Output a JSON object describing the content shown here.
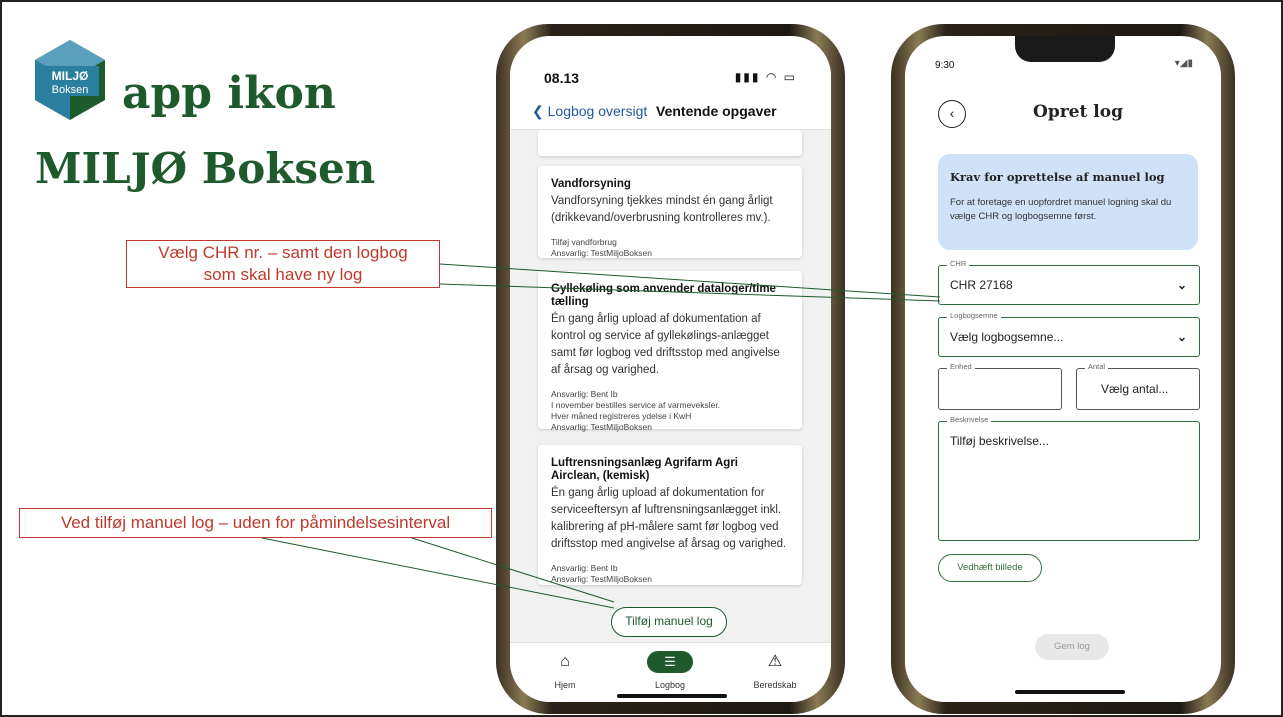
{
  "slide": {
    "title_line1": "app ikon",
    "title_line2": "MILJØ Boksen",
    "logo": {
      "icon": "miljo-boksen-logo",
      "text_top": "MILJØ",
      "text_bottom": "Boksen",
      "colors": [
        "#2a7f9e",
        "#1e5a2c",
        "#4a9ab8"
      ]
    },
    "callout1": {
      "line1": "Vælg CHR nr. – samt den logbog",
      "line2": "som skal have ny log"
    },
    "callout2": "Ved tilføj manuel log – uden for påmindelsesinterval"
  },
  "phone1": {
    "time": "08.13",
    "status_icons": "signal-icon wifi-icon battery-icon",
    "back_label": "Logbog oversigt",
    "nav_title": "Ventende opgaver",
    "cards": [
      {
        "title": "Vandforsyning",
        "desc": "Vandforsyning tjekkes mindst én gang årligt (drikkevand/overbrusning kontrolleres mv.).",
        "meta": [
          "Tilføj vandforbrug",
          "Ansvarlig: TestMiljoBoksen"
        ]
      },
      {
        "title": "Gyllekøling som anvender dataloger/time tælling",
        "desc": "Én gang årlig upload af dokumentation af kontrol og service af gyllekølings-anlægget samt før logbog ved driftsstop med angivelse af årsag og varighed.",
        "meta": [
          "Ansvarlig: Bent Ib",
          "I november bestilles service af varmeveksler.",
          "Hver måned registreres ydelse i KwH",
          "Ansvarlig: TestMiljoBoksen"
        ]
      },
      {
        "title": "Luftrensningsanlæg Agrifarm Agri Airclean, (kemisk)",
        "desc": "Én gang årlig upload af dokumentation for serviceeftersyn af luftrensningsanlægget inkl. kalibrering af pH-målere samt før logbog ved driftsstop med angivelse af årsag og varighed.",
        "meta": [
          "Ansvarlig: Bent Ib",
          "Ansvarlig: TestMiljoBoksen"
        ]
      }
    ],
    "add_button": "Tilføj manuel log",
    "tabs": [
      {
        "label": "Hjem",
        "icon": "home-icon"
      },
      {
        "label": "Logbog",
        "icon": "logbook-icon"
      },
      {
        "label": "Beredskab",
        "icon": "warning-icon"
      }
    ],
    "accent": "#1e5a2c"
  },
  "phone2": {
    "time": "9:30",
    "title": "Opret log",
    "info_title": "Krav for oprettelse af manuel log",
    "info_text": "For at foretage en uopfordret manuel logning skal du vælge CHR og logbogsemne først.",
    "fields": {
      "chr": {
        "label": "CHR",
        "value": "CHR 27168"
      },
      "logbogsemne": {
        "label": "Logbogsemne",
        "value": "Vælg logbogsemne..."
      },
      "enhed": {
        "label": "Enhed",
        "value": ""
      },
      "antal": {
        "label": "Antal",
        "value": "Vælg antal..."
      },
      "beskrivelse": {
        "label": "Beskrivelse",
        "value": "Tilføj beskrivelse..."
      }
    },
    "attach_button": "Vedhæft billede",
    "save_button": "Gem log",
    "info_bg": "#cfe2f8",
    "accent": "#2f6e3a"
  }
}
